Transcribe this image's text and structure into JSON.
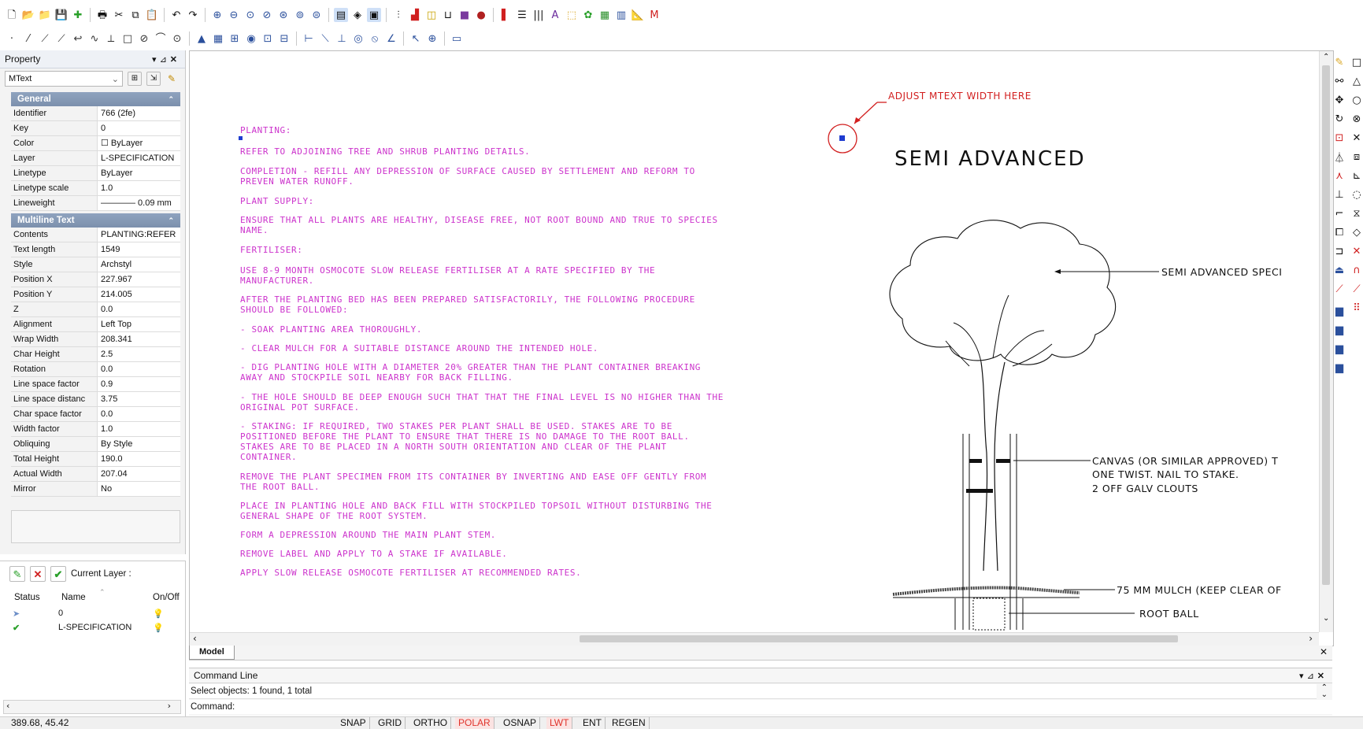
{
  "toolbar1": {
    "icons": [
      "new-icon",
      "open-icon",
      "open2-icon",
      "save-icon",
      "plus-icon",
      "print-icon",
      "cut-icon",
      "copy-icon",
      "paste-icon",
      "undo-icon",
      "redo-icon",
      "zoom-in-icon",
      "zoom-out-icon",
      "zoom-realtime-icon",
      "zoom-prev-icon",
      "zoom-window-icon",
      "zoom-extents-icon",
      "zoom-all-icon",
      "properties-icon",
      "layer-icon",
      "layout-icon",
      "align-icon",
      "hatch-icon",
      "block-icon",
      "table-icon",
      "image-icon",
      "color-icon",
      "text-style-icon",
      "lineweight-icon",
      "columns-icon",
      "text-icon",
      "xref-icon",
      "plugin-icon",
      "chart-icon",
      "sheet-icon",
      "measure-icon",
      "pdf-icon"
    ]
  },
  "property": {
    "title": "Property",
    "selected_type": "MText",
    "general": {
      "title": "General",
      "rows": [
        {
          "k": "Identifier",
          "v": "766 (2fe)"
        },
        {
          "k": "Key",
          "v": "0"
        },
        {
          "k": "Color",
          "v": "☐ ByLayer"
        },
        {
          "k": "Layer",
          "v": "L-SPECIFICATION"
        },
        {
          "k": "Linetype",
          "v": "ByLayer"
        },
        {
          "k": "Linetype scale",
          "v": "1.0"
        },
        {
          "k": "Lineweight",
          "v": "———— 0.09 mm"
        }
      ]
    },
    "multiline": {
      "title": "Multiline Text",
      "rows": [
        {
          "k": "Contents",
          "v": "PLANTING:REFER"
        },
        {
          "k": "Text length",
          "v": "1549"
        },
        {
          "k": "Style",
          "v": "Archstyl"
        },
        {
          "k": "Position X",
          "v": "227.967"
        },
        {
          "k": "Position Y",
          "v": "214.005"
        },
        {
          "k": "Z",
          "v": "0.0"
        },
        {
          "k": "Alignment",
          "v": "Left Top"
        },
        {
          "k": "Wrap Width",
          "v": "208.341"
        },
        {
          "k": "Char Height",
          "v": "2.5"
        },
        {
          "k": "Rotation",
          "v": "0.0"
        },
        {
          "k": "Line space factor",
          "v": "0.9"
        },
        {
          "k": "Line space distanc",
          "v": "3.75"
        },
        {
          "k": "Char space factor",
          "v": "0.0"
        },
        {
          "k": "Width factor",
          "v": "1.0"
        },
        {
          "k": "Obliquing",
          "v": "By Style"
        },
        {
          "k": "Total Height",
          "v": "190.0"
        },
        {
          "k": "Actual Width",
          "v": "207.04"
        },
        {
          "k": "Mirror",
          "v": "No"
        }
      ]
    }
  },
  "layers": {
    "current_label": "Current Layer :",
    "col_status": "Status",
    "col_name": "Name",
    "col_onoff": "On/Off",
    "rows": [
      {
        "status": "arrow",
        "name": "0"
      },
      {
        "status": "check",
        "name": "L-SPECIFICATION"
      }
    ]
  },
  "drawing": {
    "mtext_lines": [
      "PLANTING:",
      "REFER TO ADJOINING TREE AND SHRUB PLANTING DETAILS.",
      "COMPLETION - REFILL ANY DEPRESSION OF SURFACE CAUSED BY SETTLEMENT AND REFORM TO",
      "PREVEN WATER RUNOFF.",
      "PLANT SUPPLY:",
      "ENSURE THAT ALL PLANTS ARE HEALTHY, DISEASE FREE, NOT ROOT BOUND AND TRUE TO SPECIES",
      "NAME.",
      "FERTILISER:",
      "USE 8-9 MONTH OSMOCOTE SLOW RELEASE FERTILISER AT A RATE SPECIFIED BY THE",
      "MANUFACTURER.",
      "AFTER THE PLANTING BED HAS BEEN PREPARED SATISFACTORILY, THE FOLLOWING PROCEDURE",
      "SHOULD BE FOLLOWED:",
      "- SOAK PLANTING AREA THOROUGHLY.",
      "- CLEAR MULCH FOR A SUITABLE DISTANCE AROUND THE INTENDED HOLE.",
      "- DIG PLANTING HOLE WITH A DIAMETER 20% GREATER THAN THE PLANT CONTAINER BREAKING",
      "AWAY AND STOCKPILE SOIL NEARBY FOR BACK FILLING.",
      "- THE HOLE SHOULD BE DEEP ENOUGH SUCH THAT THAT THE FINAL LEVEL IS NO HIGHER THAN THE",
      "ORIGINAL POT SURFACE.",
      "- STAKING: IF REQUIRED, TWO STAKES PER PLANT SHALL BE USED. STAKES ARE TO BE",
      "POSITIONED BEFORE THE PLANT TO ENSURE THAT THERE IS NO DAMAGE TO THE ROOT BALL.",
      "STAKES ARE TO BE PLACED IN A NORTH SOUTH ORIENTATION AND CLEAR OF THE PLANT",
      "CONTAINER.",
      "REMOVE THE PLANT SPECIMEN FROM ITS CONTAINER BY INVERTING AND EASE OFF GENTLY FROM",
      "THE ROOT BALL.",
      "PLACE IN PLANTING HOLE AND BACK FILL WITH STOCKPILED TOPSOIL WITHOUT DISTURBING THE",
      "GENERAL SHAPE OF THE ROOT SYSTEM.",
      "FORM A DEPRESSION AROUND THE MAIN PLANT STEM.",
      "REMOVE LABEL AND APPLY TO A STAKE IF AVAILABLE.",
      "APPLY SLOW RELEASE OSMOCOTE FERTILISER AT RECOMMENDED RATES."
    ],
    "annotation": "ADJUST MTEXT WIDTH HERE",
    "heading": "SEMI ADVANCED",
    "callout_tree": "SEMI ADVANCED SPECI",
    "callout_canvas_1": "CANVAS (OR SIMILAR APPROVED) T",
    "callout_canvas_2": "ONE TWIST. NAIL TO STAKE.",
    "callout_canvas_3": "2 OFF GALV CLOUTS",
    "callout_mulch": "75 MM MULCH (KEEP CLEAR OF",
    "callout_rootball": "ROOT BALL",
    "tab_model": "Model"
  },
  "command": {
    "title": "Command Line",
    "history": "Select objects: 1 found,  1 total",
    "prompt": "Command:"
  },
  "status": {
    "coords": "389.68,  45.42",
    "buttons": [
      "SNAP",
      "GRID",
      "ORTHO",
      "POLAR",
      "OSNAP",
      "LWT",
      "ENT",
      "REGEN"
    ],
    "active": [
      "POLAR",
      "LWT"
    ]
  },
  "colors": {
    "mtext": "#cc33cc",
    "annotation": "#d21f1f",
    "active_status": "#e0342c"
  }
}
